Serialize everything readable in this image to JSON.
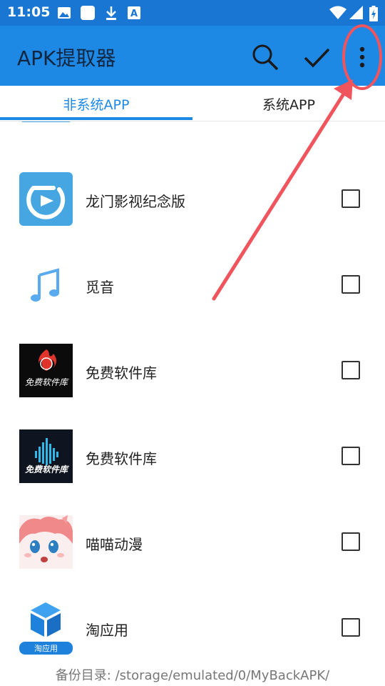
{
  "status_bar": {
    "time": "11:05",
    "icons": [
      "image-icon",
      "square-notification-icon",
      "download-icon",
      "text-a-icon",
      "wifi-icon",
      "signal-icon",
      "battery-charging-icon"
    ]
  },
  "app_bar": {
    "title": "APK提取器",
    "actions": [
      "search-icon",
      "check-icon",
      "more-vert-icon"
    ]
  },
  "tabs": [
    {
      "label": "非系统APP",
      "active": true
    },
    {
      "label": "系统APP",
      "active": false
    }
  ],
  "apps": [
    {
      "name": "",
      "icon": "video-app-icon-partial",
      "checked": false
    },
    {
      "name": "龙门影视纪念版",
      "icon": "longmen-video-icon",
      "checked": false
    },
    {
      "name": "觅音",
      "icon": "music-note-icon",
      "checked": false
    },
    {
      "name": "免费软件库",
      "icon": "free-software-red-icon",
      "checked": false
    },
    {
      "name": "免费软件库",
      "icon": "free-software-audio-icon",
      "checked": false
    },
    {
      "name": "喵喵动漫",
      "icon": "anime-girl-icon",
      "checked": false
    },
    {
      "name": "淘应用",
      "icon": "tao-app-cube-icon",
      "checked": false
    }
  ],
  "app_icon_texts": {
    "free_software": "免费软件库",
    "tao_app": "淘应用"
  },
  "footer": {
    "backup_path": "备份目录: /storage/emulated/0/MyBackAPK/"
  },
  "colors": {
    "status_bar": "#1976d2",
    "app_bar": "#1e88e5",
    "accent": "#1e88e5",
    "annotation": "#f0555e"
  }
}
